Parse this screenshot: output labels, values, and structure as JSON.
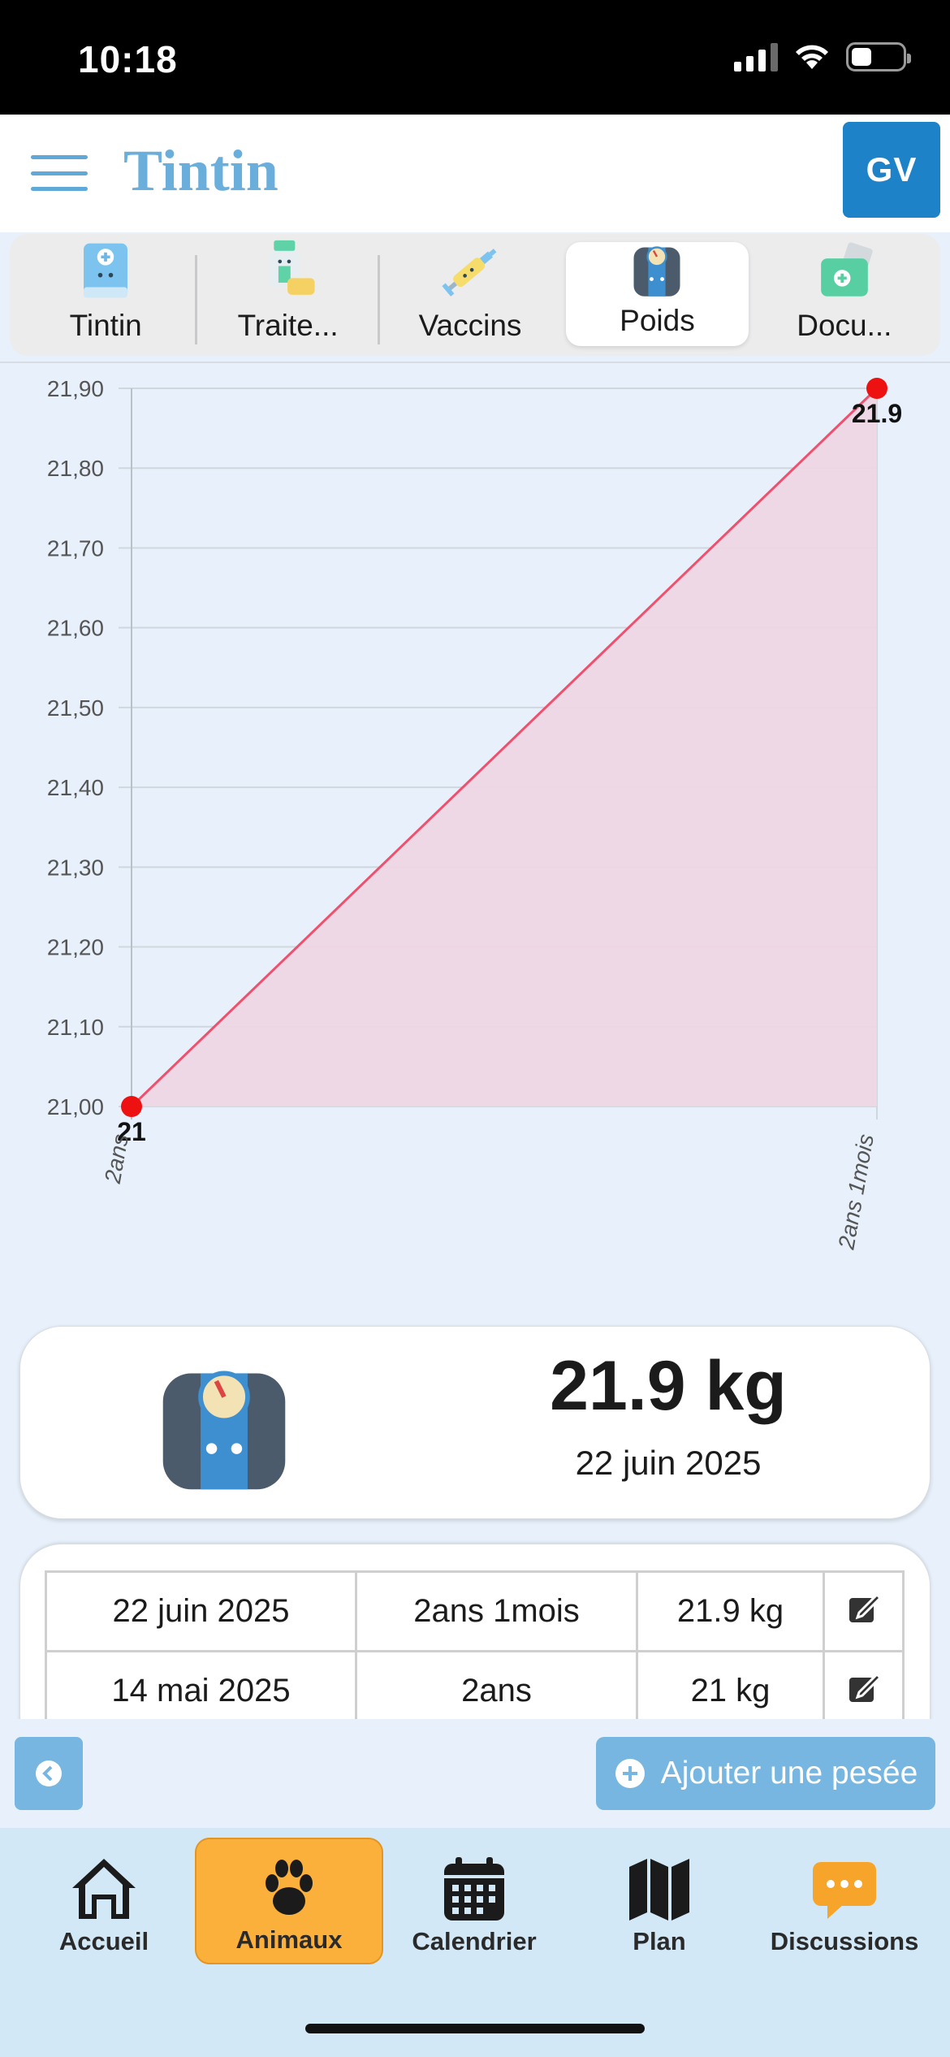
{
  "status_bar": {
    "time": "10:18"
  },
  "header": {
    "title": "Tintin",
    "avatar_initials": "GV"
  },
  "tabs": [
    {
      "label": "Tintin",
      "icon": "pet-book-icon",
      "active": false
    },
    {
      "label": "Traite...",
      "icon": "treatment-icon",
      "active": false
    },
    {
      "label": "Vaccins",
      "icon": "syringe-icon",
      "active": false
    },
    {
      "label": "Poids",
      "icon": "scale-icon",
      "active": true
    },
    {
      "label": "Docu...",
      "icon": "document-icon",
      "active": false
    }
  ],
  "chart_data": {
    "type": "area",
    "categories": [
      "2ans",
      "2ans 1mois"
    ],
    "series": [
      {
        "values": [
          21,
          21.9
        ]
      }
    ],
    "data_labels": [
      "21",
      "21.9"
    ],
    "ylim": [
      21.0,
      21.9
    ],
    "y_ticks": [
      "21,00",
      "21,10",
      "21,20",
      "21,30",
      "21,40",
      "21,50",
      "21,60",
      "21,70",
      "21,80",
      "21,90"
    ],
    "grid": true,
    "line_color": "#f0506e",
    "fill_color": "#efd5e3",
    "point_color": "#ee1111"
  },
  "summary": {
    "weight": "21.9 kg",
    "date": "22 juin 2025"
  },
  "table": {
    "rows": [
      {
        "date": "22 juin 2025",
        "age": "2ans 1mois",
        "weight": "21.9 kg"
      },
      {
        "date": "14 mai 2025",
        "age": "2ans",
        "weight": "21 kg"
      }
    ]
  },
  "actions": {
    "add_label": "Ajouter une pesée"
  },
  "bottom_nav": [
    {
      "label": "Accueil",
      "icon": "home-icon",
      "active": false
    },
    {
      "label": "Animaux",
      "icon": "paw-icon",
      "active": true
    },
    {
      "label": "Calendrier",
      "icon": "calendar-icon",
      "active": false
    },
    {
      "label": "Plan",
      "icon": "map-icon",
      "active": false
    },
    {
      "label": "Discussions",
      "icon": "chat-icon",
      "active": false
    }
  ]
}
